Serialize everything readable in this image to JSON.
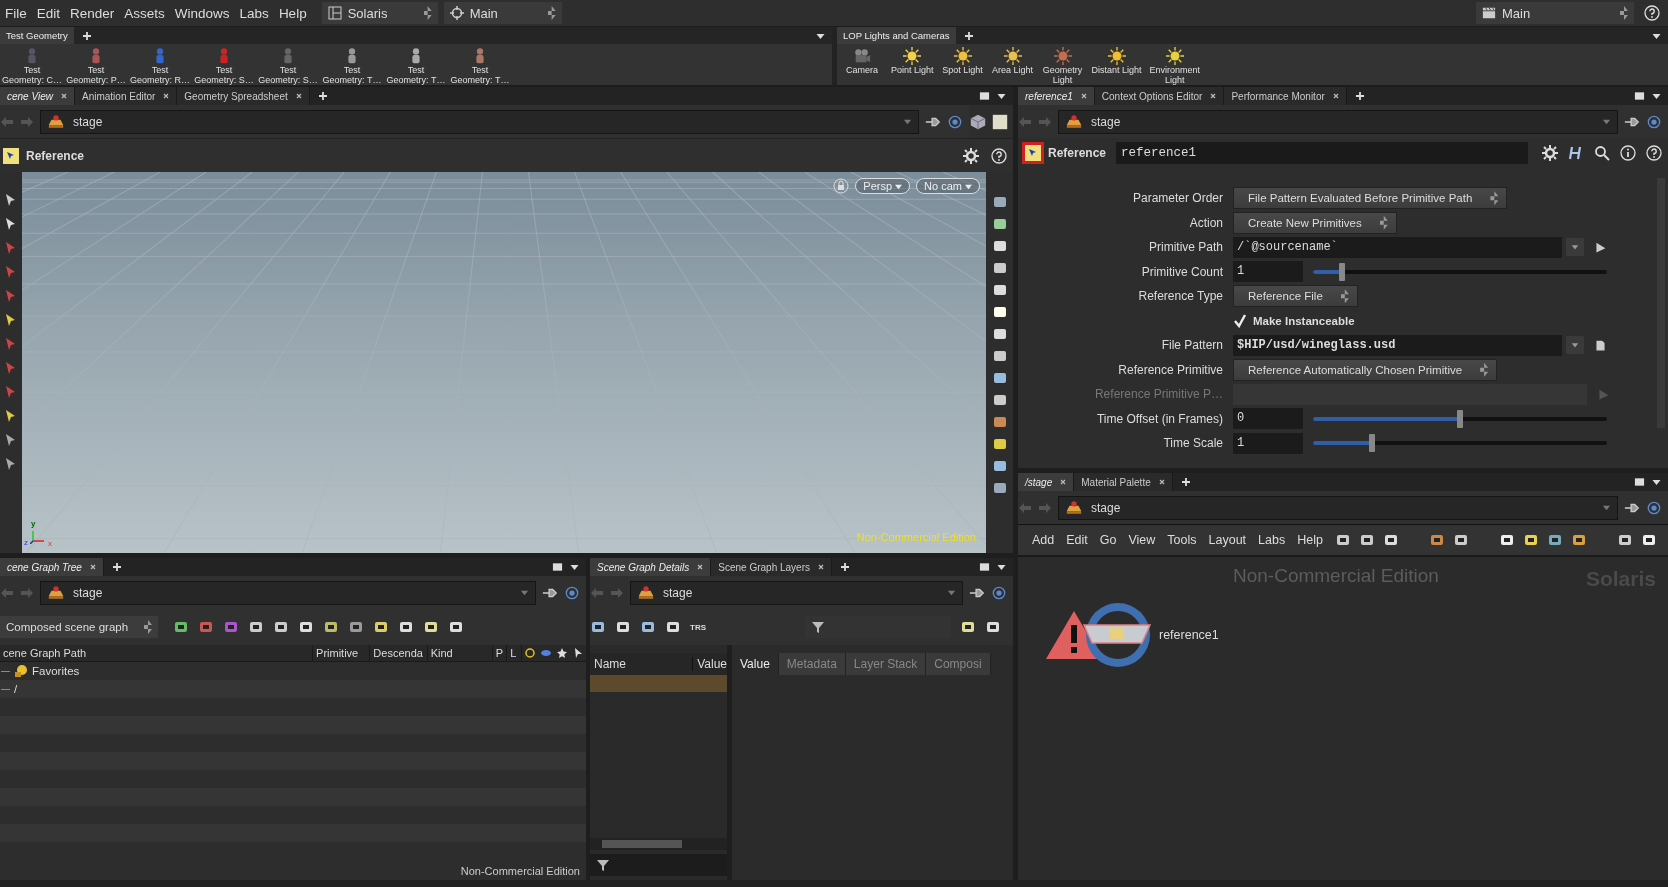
{
  "menu_bar": {
    "items": [
      "File",
      "Edit",
      "Render",
      "Assets",
      "Windows",
      "Labs",
      "Help"
    ],
    "desktop": "Solaris",
    "viewport_layout": "Main",
    "scene_selector": "Main"
  },
  "shelves": [
    {
      "tabs": [
        {
          "label": "Test Geometry",
          "selected": true
        }
      ],
      "tools": [
        {
          "kind": "geometry",
          "lines": [
            "Test",
            "Geometry: C…"
          ]
        },
        {
          "kind": "geometry",
          "lines": [
            "Test",
            "Geometry: P…"
          ]
        },
        {
          "kind": "geometry",
          "lines": [
            "Test",
            "Geometry: R…"
          ]
        },
        {
          "kind": "geometry",
          "lines": [
            "Test",
            "Geometry: S…"
          ]
        },
        {
          "kind": "geometry",
          "lines": [
            "Test",
            "Geometry: S…"
          ]
        },
        {
          "kind": "geometry",
          "lines": [
            "Test",
            "Geometry: T…"
          ]
        },
        {
          "kind": "geometry",
          "lines": [
            "Test",
            "Geometry: T…"
          ]
        },
        {
          "kind": "geometry",
          "lines": [
            "Test",
            "Geometry: T…"
          ]
        }
      ]
    },
    {
      "tabs": [
        {
          "label": "LOP Lights and Cameras",
          "selected": true
        }
      ],
      "tools": [
        {
          "kind": "camera",
          "lines": [
            "Camera"
          ]
        },
        {
          "kind": "light",
          "lines": [
            "Point Light"
          ]
        },
        {
          "kind": "light",
          "lines": [
            "Spot Light"
          ]
        },
        {
          "kind": "light",
          "lines": [
            "Area Light"
          ]
        },
        {
          "kind": "light",
          "lines": [
            "Geometry",
            "Light"
          ]
        },
        {
          "kind": "light",
          "lines": [
            "Distant Light"
          ]
        },
        {
          "kind": "light",
          "lines": [
            "Environment",
            "Light"
          ]
        }
      ]
    }
  ],
  "viewer_pane": {
    "tabs": [
      {
        "label": "cene View",
        "selected": true
      },
      {
        "label": "Animation Editor",
        "selected": false
      },
      {
        "label": "Geometry Spreadsheet",
        "selected": false
      }
    ],
    "path": "stage",
    "tool": "Reference",
    "view_menus": [
      "Persp",
      "No cam"
    ],
    "axes": [
      "y",
      "z",
      "x"
    ],
    "watermark": "Non-Commercial Edition"
  },
  "parameter_pane": {
    "tabs": [
      {
        "label": "reference1",
        "selected": true
      },
      {
        "label": "Context Options Editor",
        "selected": false
      },
      {
        "label": "Performance Monitor",
        "selected": false
      }
    ],
    "path": "stage",
    "node_type": "Reference",
    "node_name": "reference1",
    "parameters": [
      {
        "kind": "menu",
        "label": "Parameter Order",
        "value": "File Pattern Evaluated Before Primitive Path",
        "disabled": false
      },
      {
        "kind": "menu",
        "label": "Action",
        "value": "Create New Primitives",
        "disabled": false
      },
      {
        "kind": "string",
        "label": "Primitive Path",
        "value": "/`@sourcename`",
        "disabled": false
      },
      {
        "kind": "slider",
        "label": "Primitive Count",
        "value": "1",
        "level": 0.1,
        "disabled": false
      },
      {
        "kind": "menu",
        "label": "Reference Type",
        "value": "Reference File",
        "disabled": false
      },
      {
        "kind": "toggle",
        "label": "Make Instanceable",
        "checked": true,
        "disabled": false
      },
      {
        "kind": "file",
        "label": "File Pattern",
        "value": "$HIP/usd/wineglass.usd",
        "disabled": false
      },
      {
        "kind": "menu",
        "label": "Reference Primitive",
        "value": "Reference Automatically Chosen Primitive",
        "disabled": false
      },
      {
        "kind": "string",
        "label": "Reference Primitive P…",
        "disabled": true
      },
      {
        "kind": "slider",
        "label": "Time Offset (in Frames)",
        "value": "0",
        "level": 0.5,
        "disabled": false
      },
      {
        "kind": "slider",
        "label": "Time Scale",
        "value": "1",
        "level": 0.2,
        "disabled": false
      }
    ]
  },
  "scene_graph_tree": {
    "tabs": [
      {
        "label": "cene Graph Tree",
        "selected": true
      }
    ],
    "path": "stage",
    "mode": "Composed scene graph",
    "columns": [
      "cene Graph Path",
      "Primitive",
      "Descenda",
      "Kind",
      "P",
      "L"
    ],
    "rows": [
      {
        "kind": "favorites",
        "label": "Favorites"
      },
      {
        "kind": "prim",
        "label": "/"
      }
    ],
    "watermark": "Non-Commercial Edition"
  },
  "scene_graph_details": {
    "tabs": [
      {
        "label": "Scene Graph Details",
        "selected": true
      },
      {
        "label": "Scene Graph Layers",
        "selected": false
      }
    ],
    "path": "stage",
    "trs_button": "TRS",
    "columns": [
      "Name",
      "Value"
    ],
    "detail_tabs": [
      {
        "label": "Value",
        "selected": true
      },
      {
        "label": "Metadata",
        "selected": false
      },
      {
        "label": "Layer Stack",
        "selected": false
      },
      {
        "label": "Composi",
        "selected": false
      }
    ]
  },
  "network_pane": {
    "tabs": [
      {
        "label": "/stage",
        "selected": true
      },
      {
        "label": "Material Palette",
        "selected": false
      }
    ],
    "path": "stage",
    "menus": [
      "Add",
      "Edit",
      "Go",
      "View",
      "Tools",
      "Layout",
      "Labs",
      "Help"
    ],
    "watermark": "Non-Commercial Edition",
    "context": "Solaris",
    "nodes": [
      {
        "name": "reference1",
        "error": true
      }
    ]
  }
}
